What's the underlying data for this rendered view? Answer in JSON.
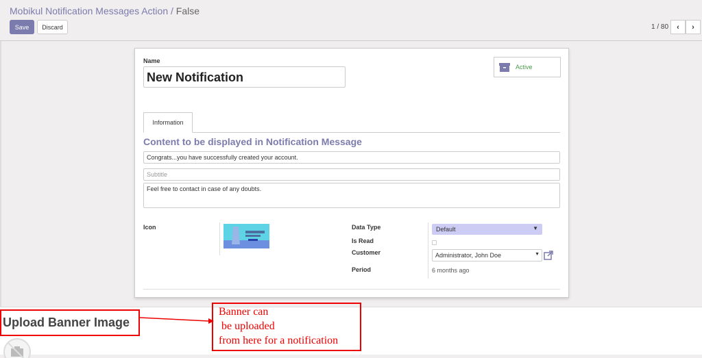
{
  "breadcrumb": {
    "parent": "Mobikul Notification Messages Action",
    "separator": "/",
    "current": "False"
  },
  "toolbar": {
    "save": "Save",
    "discard": "Discard"
  },
  "pager": {
    "value": "1 / 80",
    "prev": "‹",
    "next": "›"
  },
  "form": {
    "name_label": "Name",
    "name_value": "New Notification",
    "active_label": "Active",
    "tab": "Information",
    "section_title": "Content to be displayed in Notification Message",
    "title_value": "Congrats...you have successfully created your account.",
    "subtitle_placeholder": "Subtitle",
    "body_value": "Feel free to contact in case of any doubts.",
    "icon_label": "Icon",
    "data_type_label": "Data Type",
    "data_type_value": "Default",
    "is_read_label": "Is Read",
    "customer_label": "Customer",
    "customer_value": "Administrator, John Doe",
    "period_label": "Period",
    "period_value": "6 months ago"
  },
  "annotation": {
    "heading": "Upload Banner Image",
    "note_lines": [
      "Banner can",
      " be uploaded",
      "from here for a notification"
    ]
  },
  "colors": {
    "accent": "#7c7bad",
    "annotation": "#e00000",
    "active": "#4a9a4a"
  }
}
